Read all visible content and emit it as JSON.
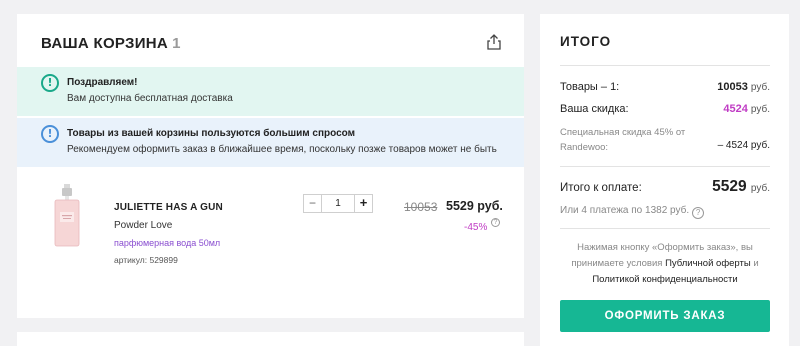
{
  "cart": {
    "title": "ВАША КОРЗИНА",
    "count": "1",
    "share_icon": "share-icon",
    "notices": [
      {
        "icon": "exclamation-icon",
        "color": "#1aa98a",
        "bg": "#e2f6f1",
        "title": "Поздравляем!",
        "text": "Вам доступна бесплатная доставка"
      },
      {
        "icon": "exclamation-icon",
        "color": "#4a90d9",
        "bg": "#e9f2fb",
        "title": "Товары из вашей корзины пользуются большим спросом",
        "text": "Рекомендуем оформить заказ в ближайшее время, поскольку позже товаров может не быть"
      }
    ],
    "item": {
      "brand": "JULIETTE HAS A GUN",
      "name": "Powder Love",
      "type": "парфюмерная вода 50мл",
      "sku": "артикул: 529899",
      "quantity": "1",
      "minus_label": "−",
      "plus_label": "+",
      "old_price": "10053",
      "price": "5529 руб.",
      "discount": "-45%",
      "help_label": "?"
    }
  },
  "summary": {
    "title": "ИТОГО",
    "goods_label": "Товары – 1:",
    "goods_value": "10053",
    "currency": "руб.",
    "discount_label": "Ваша скидка:",
    "discount_value": "4524",
    "special_label": "Специальная скидка 45% от Randewoo:",
    "special_value": "– 4524 руб.",
    "total_label": "Итого к оплате:",
    "total_value": "5529",
    "installments": "Или 4 платежа по 1382 руб.",
    "help_label": "?",
    "terms_prefix": "Нажимая кнопку «Оформить заказ», вы принимаете условия",
    "terms_offer": "Публичной оферты",
    "terms_and": "и",
    "terms_privacy": "Политикой конфиденциальности",
    "order_button": "ОФОРМИТЬ ЗАКАЗ",
    "accent_color": "#16b794",
    "discount_color": "#c03cc4"
  }
}
